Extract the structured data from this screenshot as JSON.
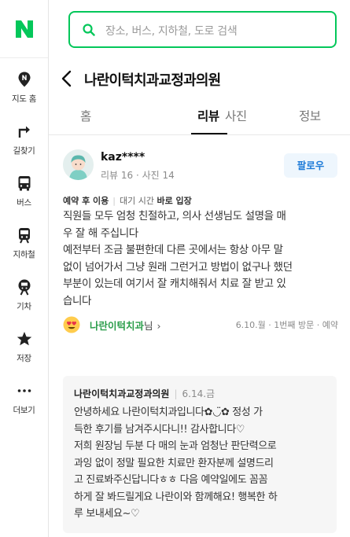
{
  "brand": {
    "accent": "#03c75a"
  },
  "rail": {
    "items": [
      {
        "icon": "pin-icon",
        "label": "지도 홈"
      },
      {
        "icon": "directions-icon",
        "label": "길찾기"
      },
      {
        "icon": "bus-icon",
        "label": "버스"
      },
      {
        "icon": "subway-icon",
        "label": "지하철"
      },
      {
        "icon": "train-icon",
        "label": "기차"
      },
      {
        "icon": "star-icon",
        "label": "저장"
      },
      {
        "icon": "more-icon",
        "label": "더보기"
      }
    ]
  },
  "search": {
    "placeholder": "장소, 버스, 지하철, 도로 검색"
  },
  "place": {
    "title": "나란이턱치과교정과의원"
  },
  "tabs": [
    "홈",
    "리뷰",
    "사진",
    "정보"
  ],
  "review": {
    "user": {
      "name": "kaz****",
      "stats": "리뷰 16 · 사진 14"
    },
    "follow_label": "팔로우",
    "visit": {
      "tag": "예약 후 이용",
      "wait_label": "대기 시간",
      "wait_value": "바로 입장"
    },
    "lines": [
      "직원들 모두 엄청 친절하고, 의사 선생님도 설명을 매",
      "우 잘 해 주십니다",
      "예전부터 조금 불편한데 다른 곳에서는 항상 아무 말",
      "없이 넘어가서 그냥 원래 그런거고 방법이 없구나 했던",
      "부분이 있는데 여기서 잘 캐치해줘서 치료 잘 받고 있",
      "습니다"
    ],
    "place_link": {
      "name": "나란이턱치과",
      "suffix": "님"
    },
    "visit_meta": "6.10.월 · 1번째 방문 · 예약"
  },
  "reply": {
    "owner": "나란이턱치과교정과의원",
    "date": "6.14.금",
    "lines": [
      "안녕하세요 나란이턱치과입니다✿◡̈✿ 정성 가",
      "득한 후기를 남겨주시다니!! 감사합니다♡",
      "저희 원장님 두분 다 매의 눈과 엄청난 판단력으로",
      "과잉 없이 정말 필요한 치료만 환자분께 설명드리",
      "고 진료봐주신답니다ㅎㅎ 다음 예약일에도 꼼꼼",
      "하게 잘 봐드릴게요 나란이와 함께해요! 행복한 하",
      "루 보내세요~♡"
    ]
  }
}
